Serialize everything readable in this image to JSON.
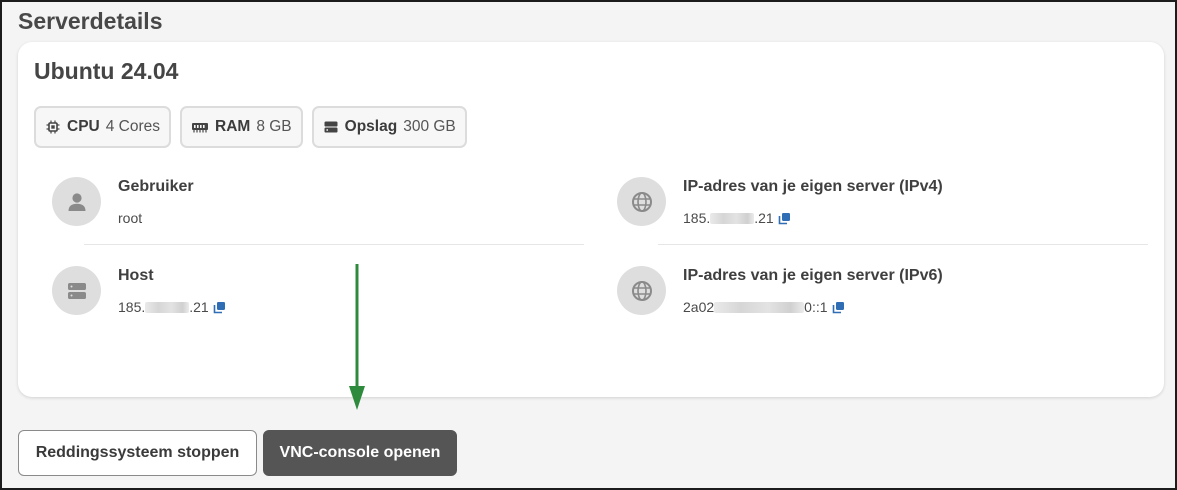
{
  "section_title": "Serverdetails",
  "server": {
    "os_name": "Ubuntu 24.04",
    "specs": [
      {
        "label": "CPU",
        "value": "4 Cores",
        "icon": "cpu-icon"
      },
      {
        "label": "RAM",
        "value": "8 GB",
        "icon": "ram-icon"
      },
      {
        "label": "Opslag",
        "value": "300 GB",
        "icon": "storage-icon"
      }
    ],
    "user": {
      "label": "Gebruiker",
      "value": "root",
      "icon": "user-icon"
    },
    "host": {
      "label": "Host",
      "value_prefix": "185.",
      "value_suffix": ".21",
      "icon": "server-icon"
    },
    "ipv4": {
      "label": "IP-adres van je eigen server (IPv4)",
      "value_prefix": "185.",
      "value_suffix": ".21",
      "icon": "globe-icon"
    },
    "ipv6": {
      "label": "IP-adres van je eigen server (IPv6)",
      "value_prefix": "2a02",
      "value_suffix": "0::1",
      "icon": "globe-icon"
    }
  },
  "actions": {
    "rescue_stop_label": "Reddingssysteem stoppen",
    "vnc_open_label": "VNC-console openen"
  },
  "colors": {
    "copy_icon": "#2f6db5",
    "primary_button": "#555555",
    "annotation_arrow": "#2e8b3e"
  }
}
